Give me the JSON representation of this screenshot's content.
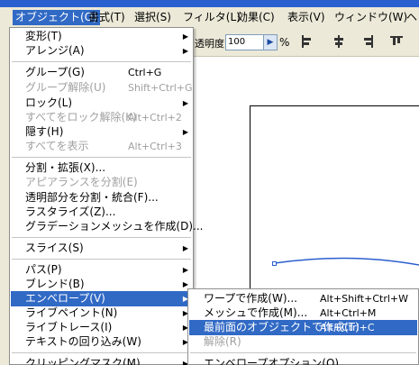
{
  "title": "",
  "menubar": {
    "items": [
      {
        "label": "オブジェクト(O)",
        "active": true
      },
      {
        "label": "書式(T)"
      },
      {
        "label": "選択(S)"
      },
      {
        "label": "フィルタ(L)"
      },
      {
        "label": "効果(C)"
      },
      {
        "label": "表示(V)"
      },
      {
        "label": "ウィンドウ(W)"
      },
      {
        "label": "ヘ"
      }
    ]
  },
  "toolbar": {
    "opacity_label": "透明度:",
    "opacity_value": "100",
    "percent": "%"
  },
  "menu": {
    "items": [
      {
        "label": "変形(T)",
        "submenu": true
      },
      {
        "label": "アレンジ(A)",
        "submenu": true
      },
      {
        "label": "グループ(G)",
        "shortcut": "Ctrl+G"
      },
      {
        "label": "グループ解除(U)",
        "shortcut": "Shift+Ctrl+G",
        "disabled": true
      },
      {
        "label": "ロック(L)",
        "submenu": true
      },
      {
        "label": "すべてをロック解除(K)",
        "shortcut": "Alt+Ctrl+2",
        "disabled": true
      },
      {
        "label": "隠す(H)",
        "submenu": true
      },
      {
        "label": "すべてを表示",
        "shortcut": "Alt+Ctrl+3",
        "disabled": true
      },
      {
        "label": "分割・拡張(X)..."
      },
      {
        "label": "アピアランスを分割(E)",
        "disabled": true
      },
      {
        "label": "透明部分を分割・統合(F)..."
      },
      {
        "label": "ラスタライズ(Z)..."
      },
      {
        "label": "グラデーションメッシュを作成(D)..."
      },
      {
        "label": "スライス(S)",
        "submenu": true
      },
      {
        "label": "パス(P)",
        "submenu": true
      },
      {
        "label": "ブレンド(B)",
        "submenu": true
      },
      {
        "label": "エンベロープ(V)",
        "submenu": true,
        "highlighted": true
      },
      {
        "label": "ライブペイント(N)",
        "submenu": true
      },
      {
        "label": "ライブトレース(I)",
        "submenu": true
      },
      {
        "label": "テキストの回り込み(W)",
        "submenu": true
      },
      {
        "label": "クリッピングマスク(M)",
        "submenu": true
      }
    ]
  },
  "submenu": {
    "items": [
      {
        "label": "ワープで作成(W)...",
        "shortcut": "Alt+Shift+Ctrl+W"
      },
      {
        "label": "メッシュで作成(M)...",
        "shortcut": "Alt+Ctrl+M"
      },
      {
        "label": "最前面のオブジェクトで作成(T)",
        "shortcut": "Alt+Ctrl+C",
        "highlighted": true
      },
      {
        "label": "解除(R)",
        "disabled": true
      },
      {
        "label": "エンベロープオプション(O)..."
      }
    ]
  },
  "colors": {
    "highlight": "#316ac5",
    "menubar_bg": "#ece9d8",
    "disabled_text": "#a0a0a0"
  }
}
